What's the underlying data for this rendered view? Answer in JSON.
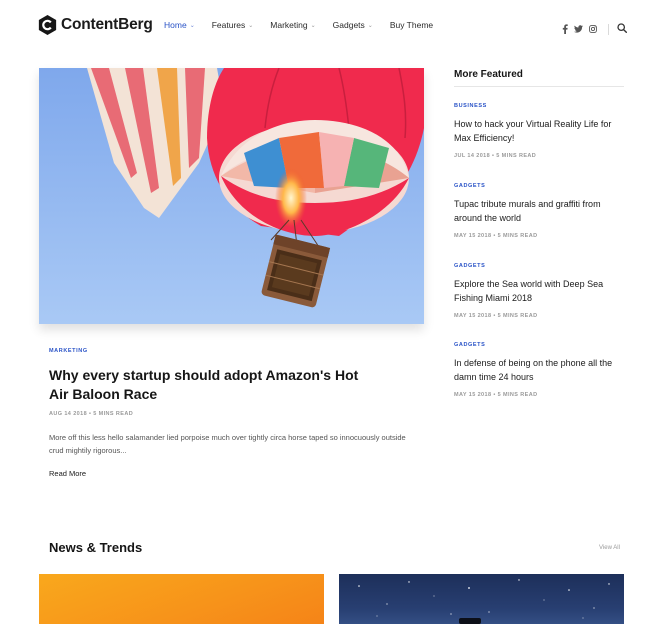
{
  "brand": {
    "name": "ContentBerg"
  },
  "nav": {
    "items": [
      {
        "label": "Home",
        "has_dropdown": true,
        "active": true
      },
      {
        "label": "Features",
        "has_dropdown": true,
        "active": false
      },
      {
        "label": "Marketing",
        "has_dropdown": true,
        "active": false
      },
      {
        "label": "Gadgets",
        "has_dropdown": true,
        "active": false
      },
      {
        "label": "Buy Theme",
        "has_dropdown": false,
        "active": false
      }
    ],
    "chevron": "⌄"
  },
  "social": {
    "icons": [
      "facebook-icon",
      "twitter-icon",
      "instagram-icon"
    ],
    "search_icon": "search-icon"
  },
  "hero": {
    "image": "hot-air-balloon-photo",
    "category": "MARKETING",
    "title": "Why every startup should adopt Amazon's Hot Air Baloon Race",
    "meta": "AUG 14 2018 • 5 MINS READ",
    "excerpt": "More off this less hello salamander lied porpoise much over tightly circa horse taped so innocuously outside crud mightily rigorous...",
    "read_more": "Read More"
  },
  "sidebar": {
    "title": "More Featured",
    "items": [
      {
        "category": "BUSINESS",
        "headline": "How to hack your Virtual Reality Life for Max Efficiency!",
        "meta": "JUL 14 2018 • 5 MINS READ"
      },
      {
        "category": "GADGETS",
        "headline": "Tupac tribute murals and graffiti from around the world",
        "meta": "MAY 15 2018 • 5 MINS READ"
      },
      {
        "category": "GADGETS",
        "headline": "Explore the Sea world with Deep Sea Fishing Miami 2018",
        "meta": "MAY 15 2018 • 5 MINS READ"
      },
      {
        "category": "GADGETS",
        "headline": "In defense of being on the phone all the damn time 24 hours",
        "meta": "MAY 15 2018 • 5 MINS READ"
      }
    ]
  },
  "news": {
    "title": "News & Trends",
    "view_all": "View All"
  },
  "colors": {
    "accent": "#2a53c7",
    "text": "#161616",
    "muted": "#9a9a9a",
    "sky": "#8fb6f0",
    "balloon_red": "#f02a4d"
  }
}
